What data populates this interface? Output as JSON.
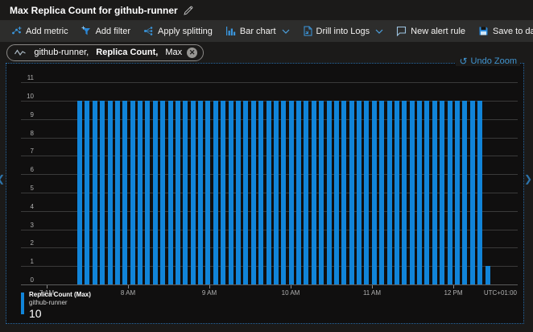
{
  "header": {
    "title": "Max Replica Count for github-runner"
  },
  "toolbar": {
    "left": [
      {
        "label": "Add metric"
      },
      {
        "label": "Add filter"
      },
      {
        "label": "Apply splitting"
      }
    ],
    "right": [
      {
        "label": "Bar chart"
      },
      {
        "label": "Drill into Logs"
      },
      {
        "label": "New alert rule"
      },
      {
        "label": "Save to dashboard"
      }
    ],
    "more_label": "···"
  },
  "metric_pill": {
    "resource": "github-runner, ",
    "metric": "Replica Count,",
    "aggregation": " Max",
    "close_glyph": "✕"
  },
  "chart": {
    "undo_zoom_label": "Undo Zoom",
    "undo_icon_glyph": "↺"
  },
  "chart_data": {
    "type": "bar",
    "title": "Max Replica Count for github-runner",
    "series": [
      {
        "name": "Replica Count (Max)",
        "resource": "github-runner",
        "values": [
          10,
          10,
          10,
          10,
          10,
          10,
          10,
          10,
          10,
          10,
          10,
          10,
          10,
          10,
          10,
          10,
          10,
          10,
          10,
          10,
          10,
          10,
          10,
          10,
          10,
          10,
          10,
          10,
          10,
          10,
          10,
          10,
          10,
          10,
          10,
          10,
          10,
          10,
          10,
          10,
          10,
          10,
          10,
          10,
          10,
          10,
          10,
          10,
          10,
          10,
          10,
          10,
          10,
          10,
          1
        ]
      }
    ],
    "ylim": [
      0,
      11
    ],
    "x_labels": [
      "7 AM",
      "8 AM",
      "9 AM",
      "10 AM",
      "11 AM",
      "12 PM"
    ],
    "timezone": "UTC+01:00",
    "bar_color": "#1184d8",
    "grid": true,
    "legend_position": "bottom-left"
  },
  "legend": {
    "metric": "Replica Count (Max)",
    "resource": "github-runner",
    "value": "10"
  },
  "colors": {
    "accent_blue": "#4da2e0",
    "bar_blue": "#1184d8",
    "toolbar_bg": "#2d2d2c",
    "page_bg": "#1b1a19",
    "chart_bg": "#100f0f",
    "border_dotted": "#2a6da8"
  }
}
